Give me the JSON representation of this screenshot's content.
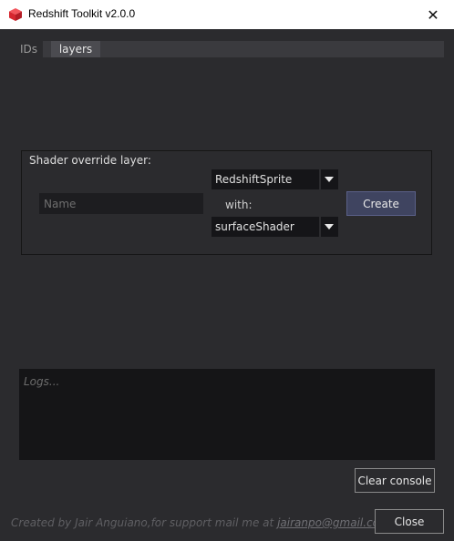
{
  "window": {
    "title": "Redshift Toolkit v2.0.0",
    "close_glyph": "✕",
    "icon": "redshift-cube-icon"
  },
  "tabs": [
    {
      "label": "IDs",
      "active": false
    },
    {
      "label": "layers",
      "active": true
    }
  ],
  "shader_override": {
    "group_title": "Shader override layer:",
    "name_placeholder": "Name",
    "name_value": "",
    "source_shader": "RedshiftSprite",
    "with_label": "with:",
    "target_shader": "surfaceShader",
    "create_label": "Create"
  },
  "console": {
    "placeholder": "Logs...",
    "clear_label": "Clear console"
  },
  "footer": {
    "credit": "Created by Jair Anguiano,for support mail me at ",
    "email": "jairanpo@gmail.com",
    "close_label": "Close"
  },
  "colors": {
    "background": "#2b2b2e",
    "accent_button": "#3f4460",
    "icon_red": "#e0343c"
  }
}
